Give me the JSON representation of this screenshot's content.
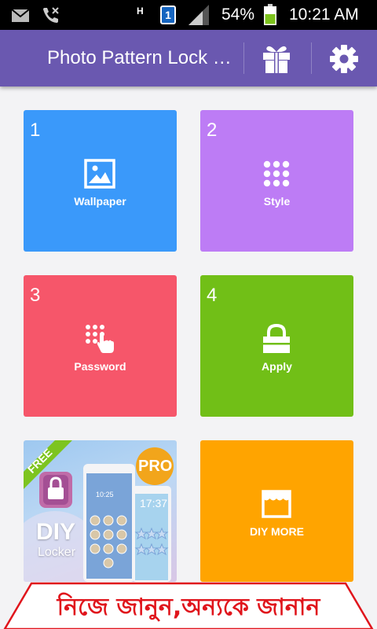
{
  "status_bar": {
    "network_type": "H",
    "sim_slot": "1",
    "battery_percent": "54%",
    "time": "10:21 AM",
    "icons": [
      "mail-icon",
      "missed-call-icon",
      "signal-icon",
      "battery-icon"
    ]
  },
  "app_bar": {
    "title": "Photo Pattern Lock Screen",
    "icons": [
      "gift-icon",
      "settings-gear-icon"
    ]
  },
  "tiles": [
    {
      "number": "1",
      "label": "Wallpaper",
      "color": "#3a99fa",
      "icon": "image-icon"
    },
    {
      "number": "2",
      "label": "Style",
      "color": "#bd7cf5",
      "icon": "dot-grid-icon"
    },
    {
      "number": "3",
      "label": "Password",
      "color": "#f6566a",
      "icon": "keypad-touch-icon"
    },
    {
      "number": "4",
      "label": "Apply",
      "color": "#71bf17",
      "icon": "lock-icon"
    },
    {
      "number": "",
      "label": "DIY MORE",
      "color": "#ffa400",
      "icon": "store-icon"
    }
  ],
  "promo": {
    "ribbon": "FREE",
    "badge": "PRO",
    "title": "DIY",
    "subtitle": "Locker",
    "phone_clock_left": "10:25",
    "phone_clock_right": "17:37"
  },
  "banner": {
    "text": "নিজে জানুন,অন্যকে জানান",
    "color": "#e0151c"
  }
}
